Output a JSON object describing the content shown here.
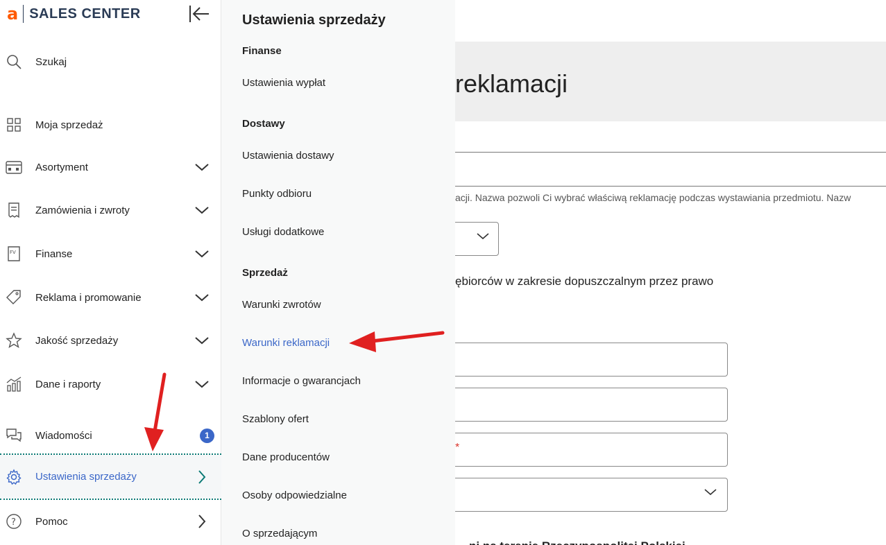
{
  "logo": {
    "mark": "a",
    "text": "SALES CENTER",
    "accent": "#ff5a00"
  },
  "sidebar": {
    "search_label": "Szukaj",
    "items": [
      {
        "label": "Moja sprzedaż"
      },
      {
        "label": "Asortyment"
      },
      {
        "label": "Zamówienia i zwroty"
      },
      {
        "label": "Finanse"
      },
      {
        "label": "Reklama i promowanie"
      },
      {
        "label": "Jakość sprzedaży"
      },
      {
        "label": "Dane i raporty"
      },
      {
        "label": "Wiadomości",
        "badge": "1"
      },
      {
        "label": "Ustawienia sprzedaży"
      },
      {
        "label": "Pomoc"
      }
    ]
  },
  "submenu": {
    "title": "Ustawienia sprzedaży",
    "sections": [
      {
        "heading": "Finanse",
        "items": [
          "Ustawienia wypłat"
        ]
      },
      {
        "heading": "Dostawy",
        "items": [
          "Ustawienia dostawy",
          "Punkty odbioru",
          "Usługi dodatkowe"
        ]
      },
      {
        "heading": "Sprzedaż",
        "items": [
          "Warunki zwrotów",
          "Warunki reklamacji",
          "Informacje o gwarancjach",
          "Szablony ofert",
          "Dane producentów",
          "Osoby odpowiedzialne",
          "O sprzedającym"
        ]
      }
    ],
    "active_item": "Warunki reklamacji"
  },
  "main": {
    "title_partial": "reklamacji",
    "hint_partial": "acji. Nazwa pozwoli Ci wybrać właściwą reklamację podczas wystawiania przedmiotu. Nazw",
    "legal_partial": "ębiorców w zakresie dopuszczalnym przez prawo",
    "required_mark": "*",
    "bottom_partial": "ni na terenie Rzeczypospolitej Polskiej"
  },
  "colors": {
    "accent": "#3b67c8",
    "arrow": "#e02020",
    "divider": "#0b7a75"
  }
}
